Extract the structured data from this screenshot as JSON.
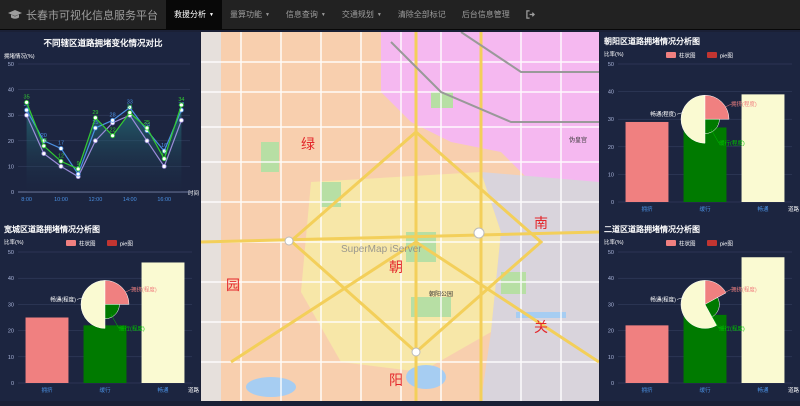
{
  "navbar": {
    "brand": "长春市可视化信息服务平台",
    "items": [
      {
        "label": "救援分析",
        "dropdown": true,
        "active": true
      },
      {
        "label": "量算功能",
        "dropdown": true
      },
      {
        "label": "信息查询",
        "dropdown": true
      },
      {
        "label": "交通规划",
        "dropdown": true
      },
      {
        "label": "清除全部标记",
        "dropdown": false
      },
      {
        "label": "后台信息管理",
        "dropdown": false
      }
    ],
    "logout_icon": "sign-out-icon"
  },
  "colors": {
    "panel_bg": "#1c2540",
    "bar_pink": "#f08080",
    "bar_green": "#007a00",
    "bar_cream": "#fafad2",
    "line_green": "#32cd32",
    "line_blue": "#4a90e2",
    "line_purple": "#9b8cd8"
  },
  "map": {
    "watermark": "SuperMap iServer",
    "districts": [
      "绿",
      "园",
      "朝",
      "阳",
      "南",
      "关"
    ],
    "landmark": "朝阳公园",
    "landmark2": "伪皇宫"
  },
  "chart_data": [
    {
      "id": "line_chart",
      "type": "line",
      "title": "不同辖区道路拥堵变化情况对比",
      "ylabel": "拥堵情况(%)",
      "xlabel": "时间",
      "ylim": [
        0,
        50
      ],
      "yticks": [
        0,
        10,
        20,
        30,
        40,
        50
      ],
      "xticks": [
        "8:00",
        "10:00",
        "12:00",
        "14:00",
        "16:00"
      ],
      "x": [
        8,
        9,
        10,
        11,
        12,
        13,
        14,
        15,
        16,
        17
      ],
      "series": [
        {
          "color": "line_green",
          "values": [
            35,
            18,
            12,
            9,
            29,
            22,
            31,
            25,
            13,
            34
          ],
          "labels": true
        },
        {
          "color": "line_blue",
          "values": [
            32,
            20,
            17,
            7,
            25,
            28,
            33,
            24,
            16,
            32
          ],
          "labels": true
        },
        {
          "color": "line_purple",
          "values": [
            30,
            15,
            10,
            6,
            20,
            27,
            30,
            20,
            10,
            28
          ],
          "labels": false
        }
      ]
    },
    {
      "id": "chaoyang",
      "type": "bar",
      "title": "朝阳区道路拥堵情况分析图",
      "ylabel": "比率(%)",
      "xlabel": "道路",
      "ylim": [
        0,
        50
      ],
      "yticks": [
        0,
        10,
        20,
        30,
        40,
        50
      ],
      "categories": [
        "拥挤",
        "缓行",
        "畅通"
      ],
      "values": [
        29,
        27,
        39
      ],
      "legend": [
        "柱状图",
        "pie图"
      ],
      "pie": {
        "slices": [
          {
            "name": "畅通(程度)",
            "value": 50
          },
          {
            "name": "拥挤(程度)",
            "value": 25
          },
          {
            "name": "缓行(程度)",
            "value": 25
          }
        ]
      }
    },
    {
      "id": "kuancheng",
      "type": "bar",
      "title": "宽城区道路拥堵情况分析图",
      "ylabel": "比率(%)",
      "xlabel": "道路",
      "ylim": [
        0,
        50
      ],
      "yticks": [
        0,
        10,
        20,
        30,
        40,
        50
      ],
      "categories": [
        "拥挤",
        "缓行",
        "畅通"
      ],
      "values": [
        25,
        22,
        46
      ],
      "legend": [
        "柱状图",
        "pie图"
      ],
      "pie": {
        "slices": [
          {
            "name": "畅通(程度)",
            "value": 50
          },
          {
            "name": "拥挤(程度)",
            "value": 25
          },
          {
            "name": "缓行(程度)",
            "value": 25
          }
        ]
      }
    },
    {
      "id": "erdao",
      "type": "bar",
      "title": "二道区道路拥堵情况分析图",
      "ylabel": "比率(%)",
      "xlabel": "道路",
      "ylim": [
        0,
        50
      ],
      "yticks": [
        0,
        10,
        20,
        30,
        40,
        50
      ],
      "categories": [
        "拥挤",
        "缓行",
        "畅通"
      ],
      "values": [
        22,
        26,
        48
      ],
      "legend": [
        "柱状图",
        "pie图"
      ],
      "pie": {
        "slices": [
          {
            "name": "畅通(程度)",
            "value": 58
          },
          {
            "name": "拥挤(程度)",
            "value": 17
          },
          {
            "name": "缓行(程度)",
            "value": 25
          }
        ]
      }
    }
  ]
}
